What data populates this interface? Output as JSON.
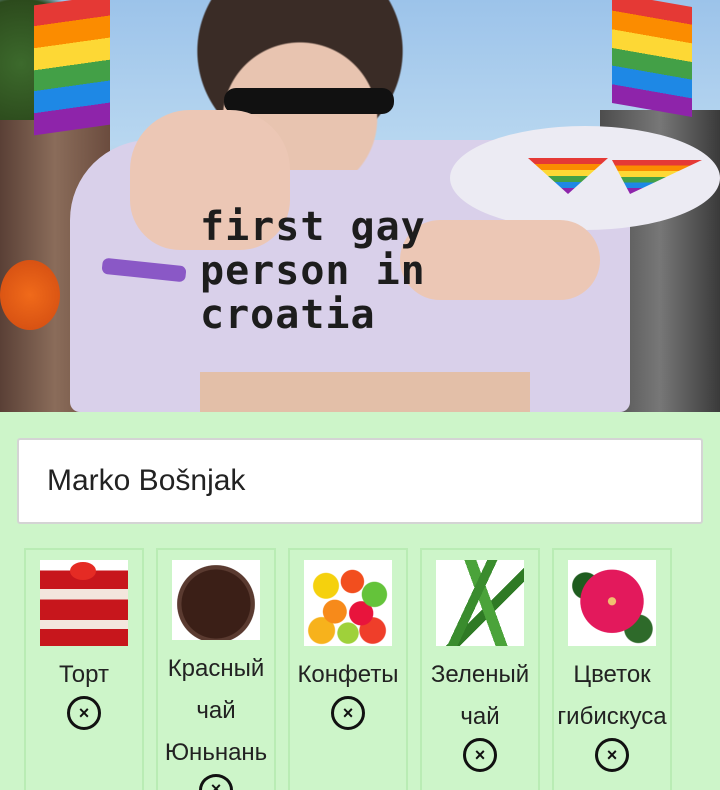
{
  "user": {
    "name": "Marko Bošnjak"
  },
  "photo": {
    "shirt_text": "first gay\nperson in\ncroatia"
  },
  "gifts": [
    {
      "label": "Торт",
      "icon": "cake-icon"
    },
    {
      "label": "Красный чай Юньнань",
      "icon": "red-tea-icon"
    },
    {
      "label": "Конфеты",
      "icon": "candy-icon"
    },
    {
      "label": "Зеленый чай",
      "icon": "green-tea-icon"
    },
    {
      "label": "Цветок гибискуса",
      "icon": "hibiscus-icon"
    }
  ],
  "remove_symbol": "×",
  "colors": {
    "background": "#cdf5c9",
    "card_border": "#b9ecb4"
  }
}
